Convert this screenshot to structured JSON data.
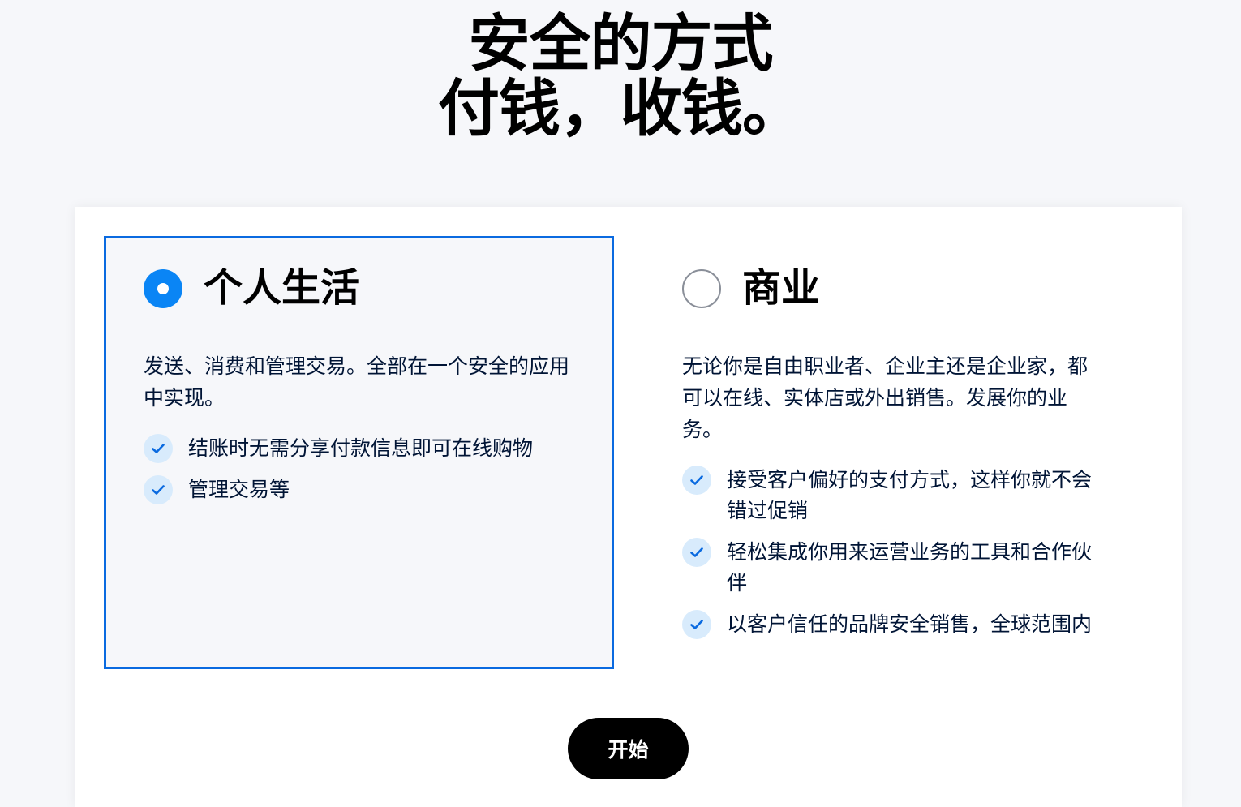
{
  "hero": {
    "line1": "安全的方式",
    "line2": "付钱，收钱。"
  },
  "options": [
    {
      "title": "个人生活",
      "selected": true,
      "description": "发送、消费和管理交易。全部在一个安全的应用中实现。",
      "features": [
        "结账时无需分享付款信息即可在线购物",
        "管理交易等"
      ]
    },
    {
      "title": "商业",
      "selected": false,
      "description": "无论你是自由职业者、企业主还是企业家，都可以在线、实体店或外出销售。发展你的业务。",
      "features": [
        "接受客户偏好的支付方式，这样你就不会错过促销",
        "轻松集成你用来运营业务的工具和合作伙伴",
        "以客户信任的品牌安全销售，全球范围内"
      ]
    }
  ],
  "cta": {
    "label": "开始"
  },
  "colors": {
    "accent": "#0a85f5",
    "border_selected": "#0a6ae0",
    "check_bg": "#d8ebfc",
    "button_bg": "#000000"
  }
}
